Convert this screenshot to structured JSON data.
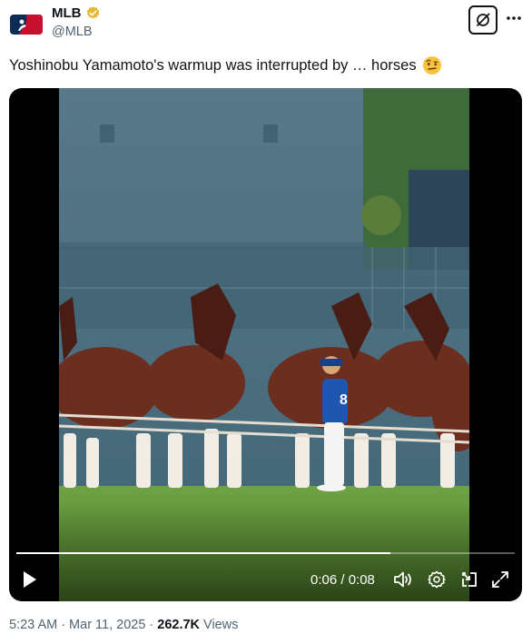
{
  "account": {
    "name": "MLB",
    "handle": "@MLB",
    "verified": true,
    "verified_color": "#e8b82f",
    "avatar_icon": "mlb-logo-icon"
  },
  "tweet": {
    "text": "Yoshinobu Yamamoto's warmup was interrupted by … horses",
    "emoji_icon": "face-with-raised-eyebrow-emoji"
  },
  "video": {
    "elapsed": "0:06",
    "duration": "0:08",
    "time_text": "0:06 / 0:08",
    "progress_fraction": 0.75,
    "player_number": "8",
    "controls": [
      "play-icon",
      "volume-icon",
      "settings-gear-icon",
      "picture-in-picture-icon",
      "fullscreen-icon"
    ]
  },
  "meta": {
    "time": "5:23 AM",
    "sep1": "·",
    "date": "Mar 11, 2025",
    "sep2": "·",
    "views_count": "262.7K",
    "views_label": "Views"
  },
  "colors": {
    "text_primary": "#0f1419",
    "text_secondary": "#536471",
    "grass": "#6ea343",
    "wall": "#4f7180"
  }
}
